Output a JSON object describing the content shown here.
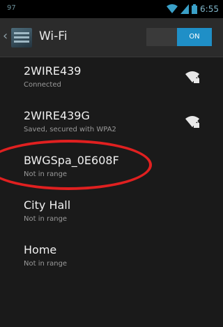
{
  "status_bar": {
    "left_text": "97",
    "time": "6:55"
  },
  "action_bar": {
    "title": "Wi-Fi",
    "toggle_label": "ON"
  },
  "networks": [
    {
      "ssid": "2WIRE439",
      "status": "Connected",
      "signal_icon": "wifi-locked-icon"
    },
    {
      "ssid": "2WIRE439G",
      "status": "Saved, secured with WPA2",
      "signal_icon": "wifi-locked-icon"
    },
    {
      "ssid": "BWGSpa_0E608F",
      "status": "Not in range"
    },
    {
      "ssid": "City Hall",
      "status": "Not in range"
    },
    {
      "ssid": "Home",
      "status": "Not in range"
    }
  ],
  "colors": {
    "accent": "#1f8fc7",
    "highlight": "#e02020"
  }
}
